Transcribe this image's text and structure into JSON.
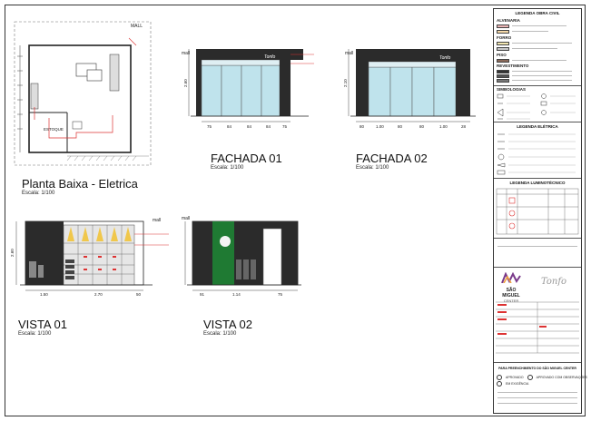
{
  "drawings": {
    "planta": {
      "title": "Planta Baixa - Eletrica",
      "scale": "Escala: 1/100",
      "mall": "MALL",
      "estoque": "ESTOQUE"
    },
    "fachada01": {
      "title": "FACHADA 01",
      "scale": "Escala: 1/100",
      "mall": "mall",
      "bottom_dims": [
        "75",
        "84",
        "84",
        "84",
        "75"
      ],
      "height": "2.60"
    },
    "fachada02": {
      "title": "FACHADA 02",
      "scale": "Escala: 1/100",
      "mall": "mall",
      "bottom_dims": [
        "80",
        "1.00",
        "80",
        "80",
        "1.00",
        "28"
      ],
      "height": "2.10"
    },
    "vista01": {
      "title": "VISTA 01",
      "scale": "Escala: 1/100",
      "mall": "mall",
      "bottom_dims": [
        "1.50",
        "2.70",
        "50"
      ],
      "height": "2.60"
    },
    "vista02": {
      "title": "VISTA 02",
      "scale": "Escala: 1/100",
      "mall": "mall",
      "bottom_dims": [
        "91",
        "1.14",
        "75"
      ],
      "height": "2.60"
    }
  },
  "legend": {
    "title": "LEGENDA OBRA CIVIL",
    "sections": [
      {
        "name": "ALVENARIA",
        "swatches": [
          "#e9b4b4",
          "#f4d8a8"
        ]
      },
      {
        "name": "FORRO",
        "swatches": [
          "#f2e6b0",
          "#c8c8c8"
        ]
      },
      {
        "name": "PISO",
        "swatches": [
          "#8b6a5a"
        ]
      },
      {
        "name": "REVESTIMENTO",
        "swatches": [
          "#333333",
          "#555555",
          "#777777",
          "#999999"
        ]
      }
    ],
    "symbols_title": "SIMBOLOGIAS",
    "electric_title": "LEGENDA ELÉTRICA",
    "lighting_title": "LEGENDA LUMINOTÉCNICO"
  },
  "title_block": {
    "center_name": "SÃO MIGUEL",
    "center_sub": "CENTER",
    "store_logo": "Tonfo",
    "approval_title": "PARA PREENCHIMENTO DO SÃO MIGUEL CENTER",
    "approval_options": [
      "APROVADO",
      "APROVADO COM OBSERVAÇÕES",
      "EM EXIGÊNCIA"
    ]
  },
  "colors": {
    "green": "#1f7a33",
    "dark": "#2b2b2b",
    "glass": "#bfe3ec",
    "red": "#d33",
    "amber": "#f2c230"
  }
}
